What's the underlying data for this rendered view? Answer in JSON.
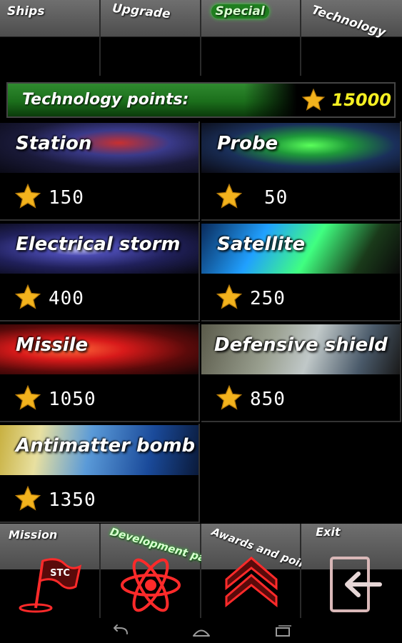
{
  "tabs": [
    {
      "label": "Ships",
      "active": false
    },
    {
      "label": "Upgrade",
      "active": false
    },
    {
      "label": "Special",
      "active": true
    },
    {
      "label": "Technology",
      "active": false
    }
  ],
  "points": {
    "label": "Technology points:",
    "icon": "star-icon",
    "value": "15000"
  },
  "items": [
    {
      "name": "Station",
      "cost": "150",
      "icon": "star-icon"
    },
    {
      "name": "Probe",
      "cost": "50",
      "icon": "star-icon"
    },
    {
      "name": "Electrical storm",
      "cost": "400",
      "icon": "star-icon"
    },
    {
      "name": "Satellite",
      "cost": "250",
      "icon": "star-icon"
    },
    {
      "name": "Missile",
      "cost": "1050",
      "icon": "star-icon"
    },
    {
      "name": "Defensive shield",
      "cost": "850",
      "icon": "star-icon"
    },
    {
      "name": "Antimatter bomb",
      "cost": "1350",
      "icon": "star-icon"
    }
  ],
  "bottom_nav": [
    {
      "label": "Mission",
      "icon": "flag-icon",
      "active": false
    },
    {
      "label": "Development panel",
      "icon": "atom-icon",
      "active": true
    },
    {
      "label": "Awards and points",
      "icon": "chevrons-up-icon",
      "active": false
    },
    {
      "label": "Exit",
      "icon": "exit-icon",
      "active": false
    }
  ],
  "colors": {
    "accent_green": "#2fd22f",
    "points_yellow": "#f4ef22",
    "star": "#f3b31d",
    "icon_red": "#ff2a2a"
  },
  "system_buttons": [
    "back-icon",
    "home-icon",
    "recent-apps-icon"
  ]
}
